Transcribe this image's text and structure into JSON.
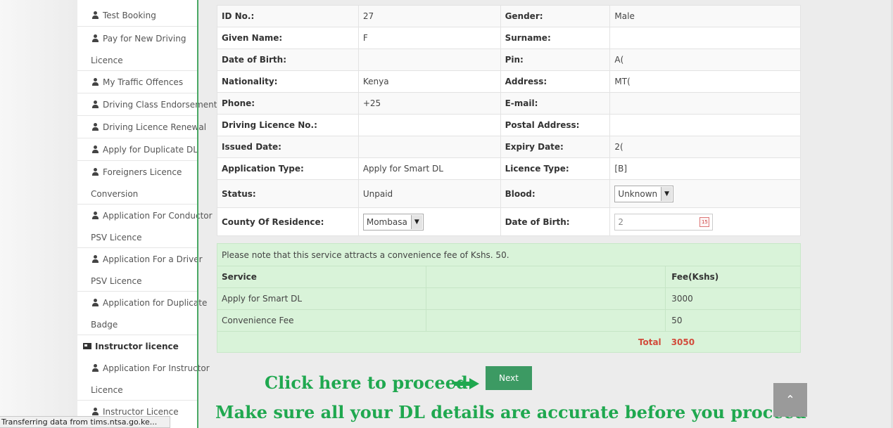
{
  "sidebar": {
    "items": [
      {
        "lines": [
          "Test Booking"
        ]
      },
      {
        "lines": [
          "Pay for New Driving",
          "Licence"
        ]
      },
      {
        "lines": [
          "My Traffic Offences"
        ]
      },
      {
        "lines": [
          "Driving Class Endorsement"
        ]
      },
      {
        "lines": [
          "Driving Licence Renewal"
        ]
      },
      {
        "lines": [
          "Apply for Duplicate DL"
        ]
      },
      {
        "lines": [
          "Foreigners Licence",
          "Conversion"
        ]
      },
      {
        "lines": [
          "Application For Conductor",
          "PSV Licence"
        ]
      },
      {
        "lines": [
          "Application For a Driver",
          "PSV Licence"
        ]
      },
      {
        "lines": [
          "Application for Duplicate",
          "Badge"
        ]
      }
    ],
    "section": "Instructor licence",
    "section_items": [
      {
        "lines": [
          "Application For Instructor",
          "Licence"
        ]
      },
      {
        "lines": [
          "Instructor Licence"
        ]
      }
    ]
  },
  "details": {
    "rows": [
      {
        "l1": "ID No.:",
        "v1": "27",
        "l2": "Gender:",
        "v2": "Male"
      },
      {
        "l1": "Given Name:",
        "v1": "F",
        "l2": "Surname:",
        "v2": ""
      },
      {
        "l1": "Date of Birth:",
        "v1": "",
        "l2": "Pin:",
        "v2": "A("
      },
      {
        "l1": "Nationality:",
        "v1": "Kenya",
        "l2": "Address:",
        "v2": "MT("
      },
      {
        "l1": "Phone:",
        "v1": "+25",
        "l2": "E-mail:",
        "v2": ""
      },
      {
        "l1": "Driving Licence No.:",
        "v1": "",
        "l2": "Postal Address:",
        "v2": ""
      },
      {
        "l1": "Issued Date:",
        "v1": "",
        "l2": "Expiry Date:",
        "v2": "2("
      },
      {
        "l1": "Application Type:",
        "v1": "Apply for Smart DL",
        "l2": "Licence Type:",
        "v2": "[B]"
      }
    ],
    "status_label": "Status:",
    "status_value": "Unpaid",
    "blood_label": "Blood:",
    "blood_value": "Unknown",
    "county_label": "County Of Residence:",
    "county_value": "Mombasa",
    "dob_label": "Date of Birth:",
    "dob_value": "2"
  },
  "fees": {
    "note": "Please note that this service attracts a convenience fee of Kshs. 50.",
    "header_service": "Service",
    "header_fee": "Fee(Kshs)",
    "rows": [
      {
        "service": "Apply for Smart DL",
        "fee": "3000"
      },
      {
        "service": "Convenience Fee",
        "fee": "50"
      }
    ],
    "total_label": "Total",
    "total_value": "3050"
  },
  "annotations": {
    "proceed": "Click here to proceed",
    "warning": "Make sure all your DL details are accurate before you proceed"
  },
  "next_label": "Next",
  "scroll_top_symbol": "⌃",
  "status_bar": "Transferring data from tims.ntsa.go.ke..."
}
